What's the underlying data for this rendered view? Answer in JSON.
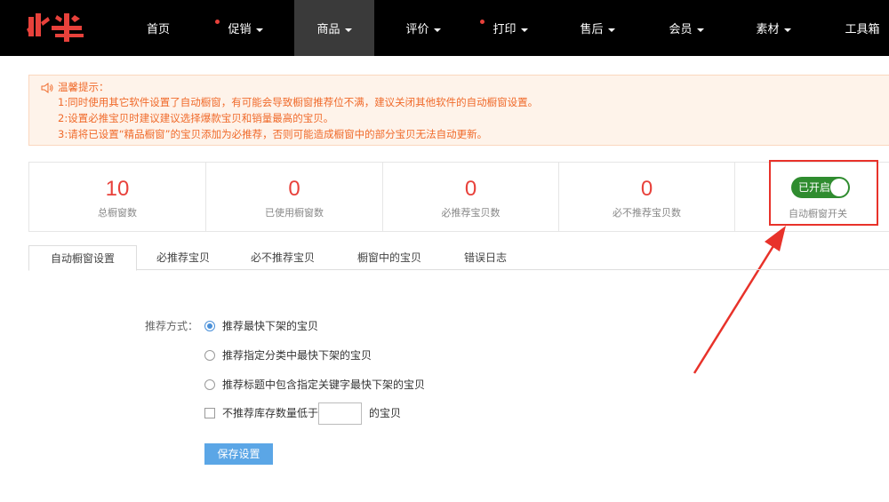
{
  "colors": {
    "nav_bg": "#000000",
    "accent_red": "#e8413b",
    "tip_text": "#f06a2a",
    "toggle_green": "#2f8c2f",
    "button_blue": "#5ba6e6"
  },
  "nav": {
    "logo_icon": "huoniu-logo",
    "items": [
      {
        "label": "首页",
        "dot": false,
        "caret": false,
        "active": false
      },
      {
        "label": "促销",
        "dot": true,
        "caret": true,
        "active": false
      },
      {
        "label": "商品",
        "dot": false,
        "caret": true,
        "active": true
      },
      {
        "label": "评价",
        "dot": false,
        "caret": true,
        "active": false
      },
      {
        "label": "打印",
        "dot": true,
        "caret": true,
        "active": false
      },
      {
        "label": "售后",
        "dot": false,
        "caret": true,
        "active": false
      },
      {
        "label": "会员",
        "dot": false,
        "caret": true,
        "active": false
      },
      {
        "label": "素材",
        "dot": false,
        "caret": true,
        "active": false
      },
      {
        "label": "工具箱",
        "dot": false,
        "caret": false,
        "active": false
      }
    ]
  },
  "tips": {
    "icon": "speaker-icon",
    "title": "温馨提示：",
    "lines": [
      "1:同时使用其它软件设置了自动橱窗，有可能会导致橱窗推荐位不满，建议关闭其他软件的自动橱窗设置。",
      "2:设置必推宝贝时建议建议选择爆款宝贝和销量最高的宝贝。",
      "3:请将已设置“精品橱窗”的宝贝添加为必推荐，否则可能造成橱窗中的部分宝贝无法自动更新。"
    ]
  },
  "stats": [
    {
      "value": "10",
      "label": "总橱窗数"
    },
    {
      "value": "0",
      "label": "已使用橱窗数"
    },
    {
      "value": "0",
      "label": "必推荐宝贝数"
    },
    {
      "value": "0",
      "label": "必不推荐宝贝数"
    }
  ],
  "auto_switch": {
    "state_label": "已开启",
    "on": true,
    "label": "自动橱窗开关"
  },
  "tabs": [
    "自动橱窗设置",
    "必推荐宝贝",
    "必不推荐宝贝",
    "橱窗中的宝贝",
    "错误日志"
  ],
  "active_tab": 0,
  "form": {
    "label": "推荐方式：",
    "options": [
      {
        "label": "推荐最快下架的宝贝",
        "selected": true
      },
      {
        "label": "推荐指定分类中最快下架的宝贝",
        "selected": false
      },
      {
        "label": "推荐标题中包含指定关键字最快下架的宝贝",
        "selected": false
      }
    ],
    "stock_checkbox_label": "不推荐库存数量低于",
    "stock_checked": false,
    "stock_value": "",
    "stock_suffix": "的宝贝",
    "save_label": "保存设置"
  }
}
